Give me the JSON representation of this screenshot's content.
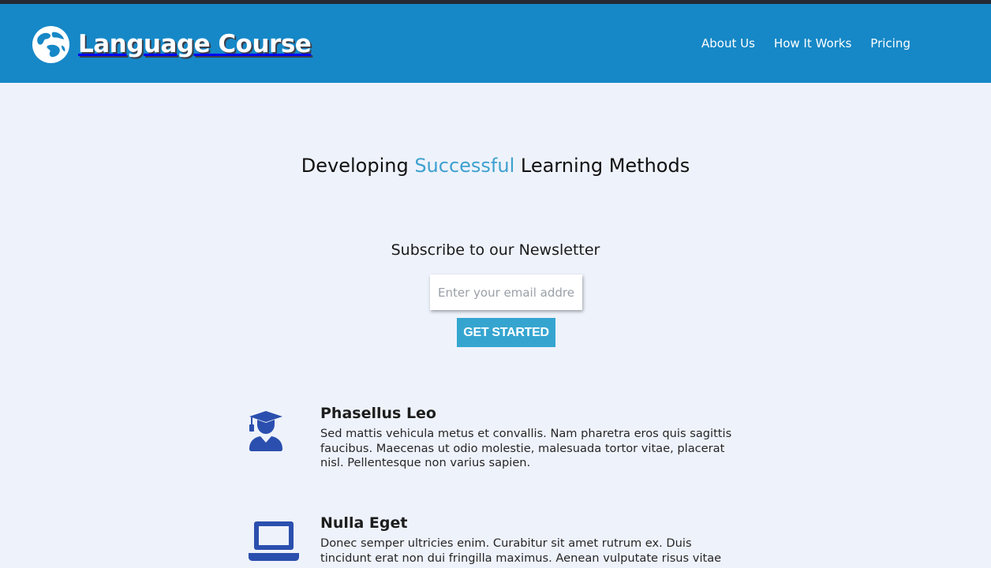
{
  "header": {
    "brand": "Language Course",
    "nav": [
      {
        "label": "About Us"
      },
      {
        "label": "How It Works"
      },
      {
        "label": "Pricing"
      }
    ]
  },
  "hero": {
    "headline_before": "Developing ",
    "headline_accent": "Successful",
    "headline_after": " Learning Methods"
  },
  "newsletter": {
    "title": "Subscribe to our Newsletter",
    "email_placeholder": "Enter your email address",
    "email_value": "",
    "button_label": "GET STARTED"
  },
  "features": [
    {
      "icon": "graduate-icon",
      "title": "Phasellus Leo",
      "text": "Sed mattis vehicula metus et convallis. Nam pharetra eros quis sagittis faucibus. Maecenas ut odio molestie, malesuada tortor vitae, placerat nisl. Pellentesque non varius sapien."
    },
    {
      "icon": "laptop-icon",
      "title": "Nulla Eget",
      "text": "Donec semper ultricies enim. Curabitur sit amet rutrum ex. Duis tincidunt erat non dui fringilla maximus. Aenean vulputate risus vitae"
    }
  ],
  "colors": {
    "header_bg": "#1688c7",
    "page_bg": "#eef2fb",
    "accent": "#3da1cf",
    "button_bg": "#35a5d0",
    "icon_color": "#2b4fae"
  }
}
